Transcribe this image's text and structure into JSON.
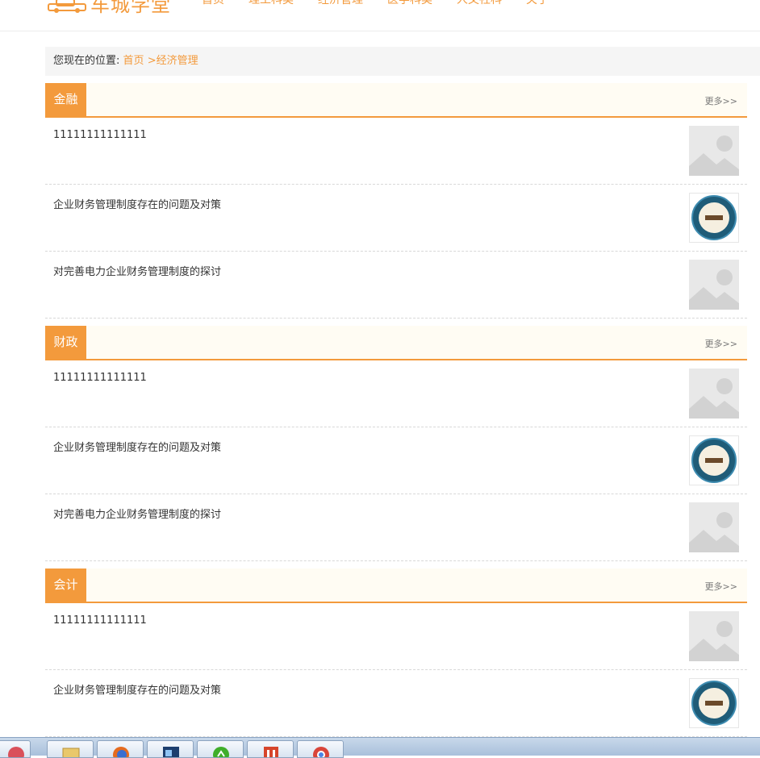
{
  "header": {
    "logo_text": "车城学堂",
    "nav": [
      {
        "label": "首页"
      },
      {
        "label": "理工科类"
      },
      {
        "label": "经济管理"
      },
      {
        "label": "医学科类"
      },
      {
        "label": "人文社科"
      },
      {
        "label": "关于"
      }
    ]
  },
  "breadcrumb": {
    "prefix": "您现在的位置:",
    "home": "首页",
    "current": ">经济管理"
  },
  "sections": [
    {
      "title": "金融",
      "more": "更多>>",
      "items": [
        {
          "title": "11111111111111",
          "thumb": "placeholder-image"
        },
        {
          "title": "企业财务管理制度存在的问题及对策",
          "thumb": "emblem-logo"
        },
        {
          "title": "对完善电力企业财务管理制度的探讨",
          "thumb": "placeholder-image"
        }
      ]
    },
    {
      "title": "财政",
      "more": "更多>>",
      "items": [
        {
          "title": "11111111111111",
          "thumb": "placeholder-image"
        },
        {
          "title": "企业财务管理制度存在的问题及对策",
          "thumb": "emblem-logo"
        },
        {
          "title": "对完善电力企业财务管理制度的探讨",
          "thumb": "placeholder-image"
        }
      ]
    },
    {
      "title": "会计",
      "more": "更多>>",
      "items": [
        {
          "title": "11111111111111",
          "thumb": "placeholder-image"
        },
        {
          "title": "企业财务管理制度存在的问题及对策",
          "thumb": "emblem-logo"
        }
      ]
    }
  ],
  "taskbar": {
    "apps": [
      "file-explorer-icon",
      "firefox-icon",
      "photoshop-icon",
      "green-app-icon",
      "hbuilder-icon",
      "chrome-icon"
    ]
  },
  "colors": {
    "accent": "#f39a3c",
    "section_bg": "#fffcf3",
    "breadcrumb_bg": "#f5f5f5"
  }
}
